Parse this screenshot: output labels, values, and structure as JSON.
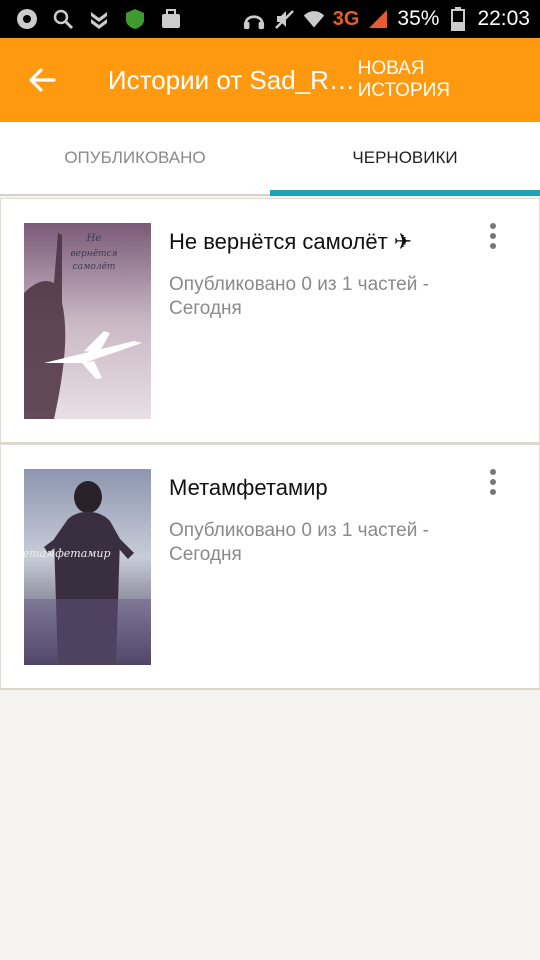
{
  "status_bar": {
    "network": "3G",
    "battery": "35%",
    "time": "22:03"
  },
  "app_bar": {
    "title": "Истории от Sad_Ra...",
    "action": "НОВАЯ ИСТОРИЯ"
  },
  "tabs": [
    {
      "label": "ОПУБЛИКОВАНО",
      "active": false
    },
    {
      "label": "ЧЕРНОВИКИ",
      "active": true
    }
  ],
  "stories": [
    {
      "title": "Не вернётся самолёт ✈",
      "meta": "Опубликовано 0 из 1 частей - Сегодня",
      "cover_text": "Не вернётся самолёт"
    },
    {
      "title": "Метамфетамир",
      "meta": "Опубликовано 0 из 1 частей - Сегодня",
      "cover_text": "метамфетамир"
    }
  ],
  "colors": {
    "app_bar": "#ff9a10",
    "tab_indicator": "#1ba4b5",
    "background": "#f5f3f0"
  }
}
